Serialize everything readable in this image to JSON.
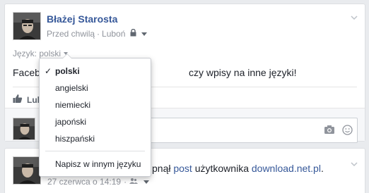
{
  "post1": {
    "author": "Błażej Starosta",
    "time": "Przed chwilą",
    "separator": "·",
    "location": "Luboń",
    "language_label": "Język: polski",
    "text_left": "Faceb",
    "text_right": "czy wpisy na inne języki!",
    "like_label": "Lub",
    "comment_placeholder": ""
  },
  "dropdown": {
    "items": [
      {
        "label": "polski",
        "selected": true
      },
      {
        "label": "angielski"
      },
      {
        "label": "niemiecki"
      },
      {
        "label": "japoński"
      },
      {
        "label": "hiszpański"
      }
    ],
    "other": "Napisz w innym języku"
  },
  "post2": {
    "text_prefix": "pnął",
    "post_word": "post",
    "middle": "użytkownika",
    "source": "download.net.pl",
    "trailing": ".",
    "date": "27 czerwca o 14:19",
    "separator": "·"
  },
  "colors": {
    "link": "#365899",
    "meta": "#90949c",
    "background": "#e9ebee"
  },
  "icons": [
    "lock-icon",
    "check-icon",
    "like-icon",
    "camera-icon",
    "emoji-icon",
    "chevron-down-icon",
    "friends-icon"
  ]
}
